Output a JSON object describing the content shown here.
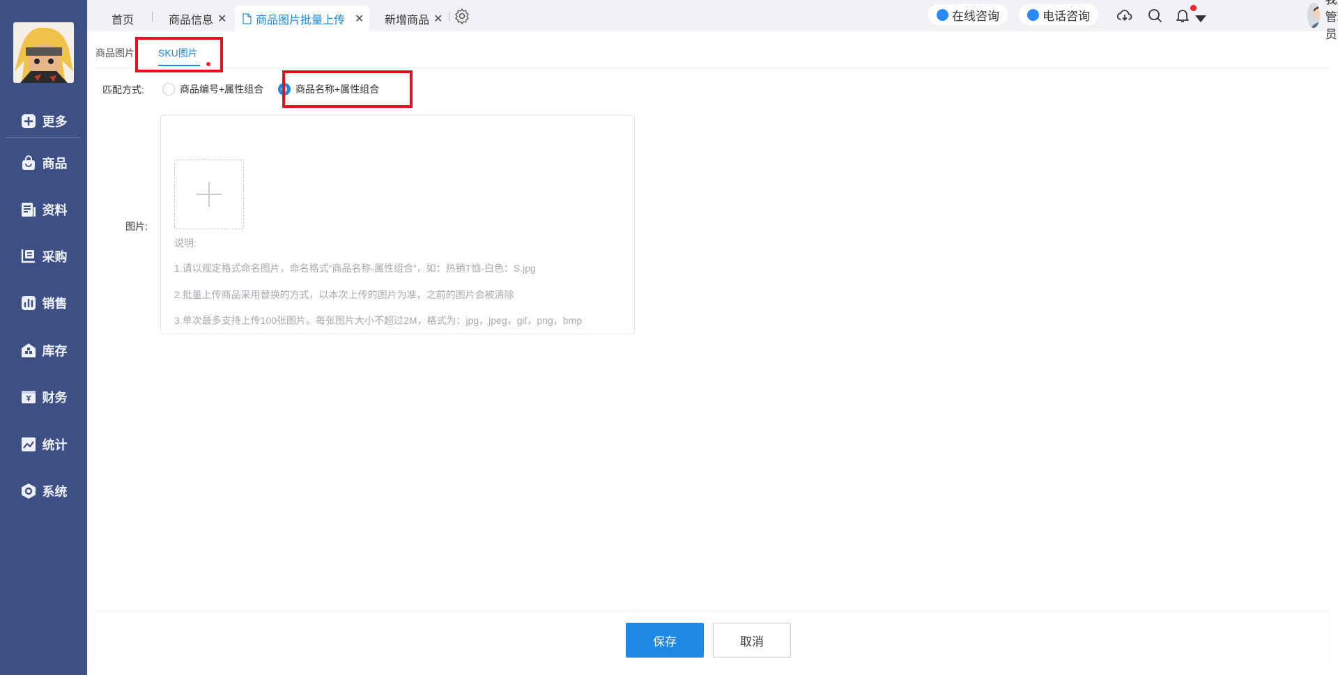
{
  "sidebar": {
    "items": [
      {
        "label": "更多",
        "icon": "plus-square-icon"
      },
      {
        "label": "商品",
        "icon": "shopping-bag-icon"
      },
      {
        "label": "资料",
        "icon": "document-icon"
      },
      {
        "label": "采购",
        "icon": "purchase-icon"
      },
      {
        "label": "销售",
        "icon": "bar-chart-icon"
      },
      {
        "label": "库存",
        "icon": "warehouse-icon"
      },
      {
        "label": "财务",
        "icon": "yuan-wallet-icon"
      },
      {
        "label": "统计",
        "icon": "line-chart-icon"
      },
      {
        "label": "系统",
        "icon": "hexagon-gear-icon"
      }
    ]
  },
  "topbar": {
    "tabs": [
      {
        "label": "首页"
      },
      {
        "label": "商品信息",
        "close": "✕"
      },
      {
        "label": "商品图片批量上传",
        "close": "✕"
      },
      {
        "label": "新增商品",
        "close": "✕"
      }
    ],
    "online_consult": "在线咨询",
    "phone_consult": "电话咨询",
    "user_name": "我是管理员"
  },
  "subtabs": [
    "商品图片",
    "SKU图片"
  ],
  "form": {
    "match_label": "匹配方式:",
    "options": [
      "商品编号+属性组合",
      "商品名称+属性组合"
    ],
    "image_label": "图片:",
    "notes": [
      "说明:",
      "1.请以规定格式命名图片，命名格式“商品名称-属性组合”，如：热销T恤-白色：S.jpg",
      "2.批量上传商品采用替换的方式，以本次上传的图片为准，之前的图片会被清除",
      "3.单次最多支持上传100张图片。每张图片大小不超过2M，格式为：jpg，jpeg，gif，png，bmp"
    ]
  },
  "footer": {
    "save": "保存",
    "cancel": "取消"
  },
  "colors": {
    "sidebar_bg": "#3e4f86",
    "primary": "#1e88e5",
    "highlight": "#e5101a"
  }
}
